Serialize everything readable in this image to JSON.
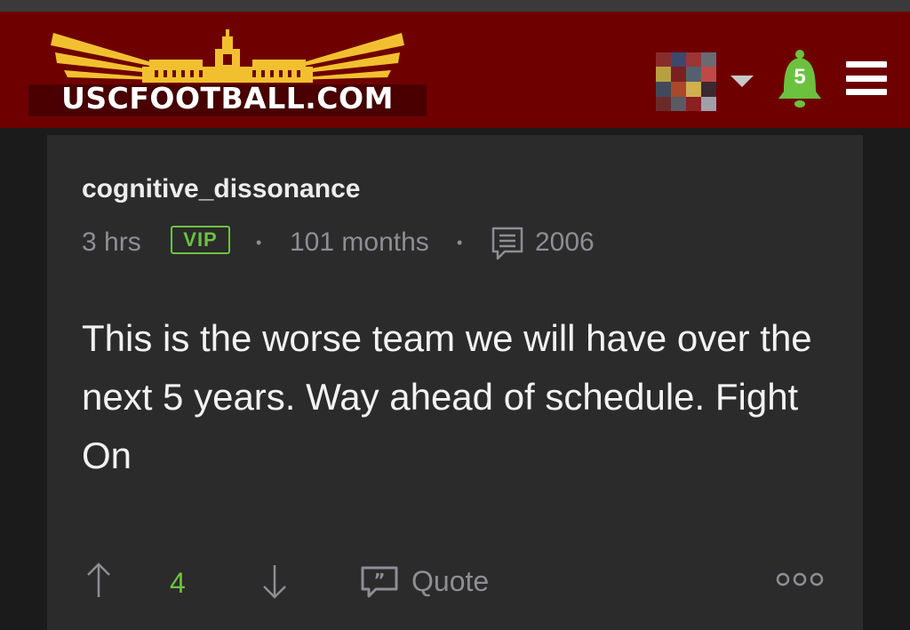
{
  "header": {
    "logo_text": "USCFOOTBALL.COM",
    "brand_color": "#6e0000",
    "logo_accent_color": "#f2c02f",
    "notification_count": "5",
    "notification_color": "#6cc23f"
  },
  "post": {
    "username": "cognitive_dissonance",
    "time_ago": "3 hrs",
    "badge": "VIP",
    "separator": "•",
    "membership": "101 months",
    "post_count": "2006",
    "body": "This is the worse team we will have over the next 5 years. Way ahead of schedule. Fight On",
    "actions": {
      "vote_count": "4",
      "quote_label": "Quote",
      "more_label": "ooo"
    },
    "icons": [
      "arrow-up-icon",
      "arrow-down-icon",
      "quote-icon",
      "more-icon",
      "comments-icon"
    ]
  }
}
